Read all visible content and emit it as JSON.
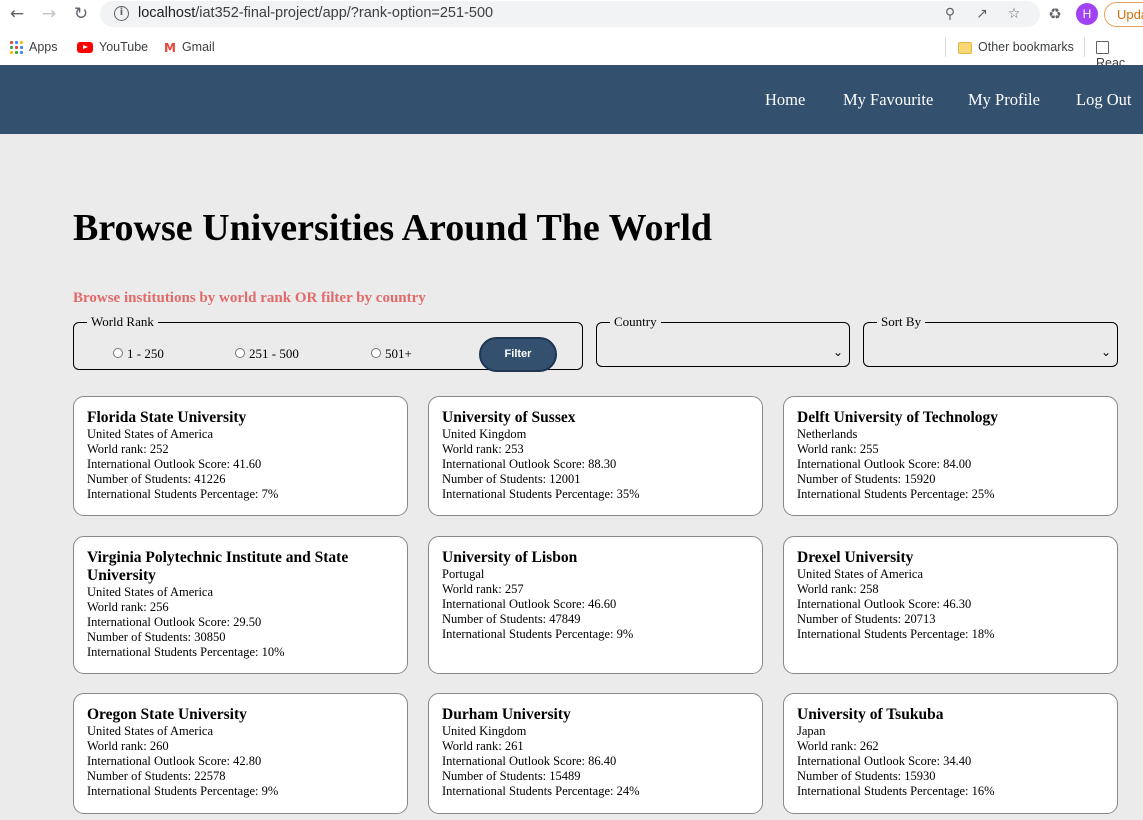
{
  "browser": {
    "url_host": "localhost",
    "url_path": "/iat352-final-project/app/?rank-option=251-500",
    "profile_initial": "H",
    "update_label": "Upda",
    "bookmarks": {
      "apps": "Apps",
      "youtube": "YouTube",
      "gmail": "Gmail",
      "other": "Other bookmarks",
      "reading": "Reac"
    }
  },
  "nav": {
    "home": "Home",
    "favourite": "My Favourite",
    "profile": "My Profile",
    "logout": "Log Out"
  },
  "page": {
    "title": "Browse Universities Around The World",
    "subtitle": "Browse institutions by world rank OR filter by country"
  },
  "filters": {
    "rank_legend": "World Rank",
    "rank_options": [
      "1 - 250",
      "251 - 500",
      "501+"
    ],
    "filter_button": "Filter",
    "country_legend": "Country",
    "sort_legend": "Sort By"
  },
  "universities": [
    {
      "name": "Florida State University",
      "country": "United States of America",
      "rank": "World rank: 252",
      "outlook": "International Outlook Score: 41.60",
      "students": "Number of Students: 41226",
      "intl": "International Students Percentage: 7%"
    },
    {
      "name": "University of Sussex",
      "country": "United Kingdom",
      "rank": "World rank: 253",
      "outlook": "International Outlook Score: 88.30",
      "students": "Number of Students: 12001",
      "intl": "International Students Percentage: 35%"
    },
    {
      "name": "Delft University of Technology",
      "country": "Netherlands",
      "rank": "World rank: 255",
      "outlook": "International Outlook Score: 84.00",
      "students": "Number of Students: 15920",
      "intl": "International Students Percentage: 25%"
    },
    {
      "name": "Virginia Polytechnic Institute and State University",
      "country": "United States of America",
      "rank": "World rank: 256",
      "outlook": "International Outlook Score: 29.50",
      "students": "Number of Students: 30850",
      "intl": "International Students Percentage: 10%"
    },
    {
      "name": "University of Lisbon",
      "country": "Portugal",
      "rank": "World rank: 257",
      "outlook": "International Outlook Score: 46.60",
      "students": "Number of Students: 47849",
      "intl": "International Students Percentage: 9%"
    },
    {
      "name": "Drexel University",
      "country": "United States of America",
      "rank": "World rank: 258",
      "outlook": "International Outlook Score: 46.30",
      "students": "Number of Students: 20713",
      "intl": "International Students Percentage: 18%"
    },
    {
      "name": "Oregon State University",
      "country": "United States of America",
      "rank": "World rank: 260",
      "outlook": "International Outlook Score: 42.80",
      "students": "Number of Students: 22578",
      "intl": "International Students Percentage: 9%"
    },
    {
      "name": "Durham University",
      "country": "United Kingdom",
      "rank": "World rank: 261",
      "outlook": "International Outlook Score: 86.40",
      "students": "Number of Students: 15489",
      "intl": "International Students Percentage: 24%"
    },
    {
      "name": "University of Tsukuba",
      "country": "Japan",
      "rank": "World rank: 262",
      "outlook": "International Outlook Score: 34.40",
      "students": "Number of Students: 15930",
      "intl": "International Students Percentage: 16%"
    }
  ]
}
